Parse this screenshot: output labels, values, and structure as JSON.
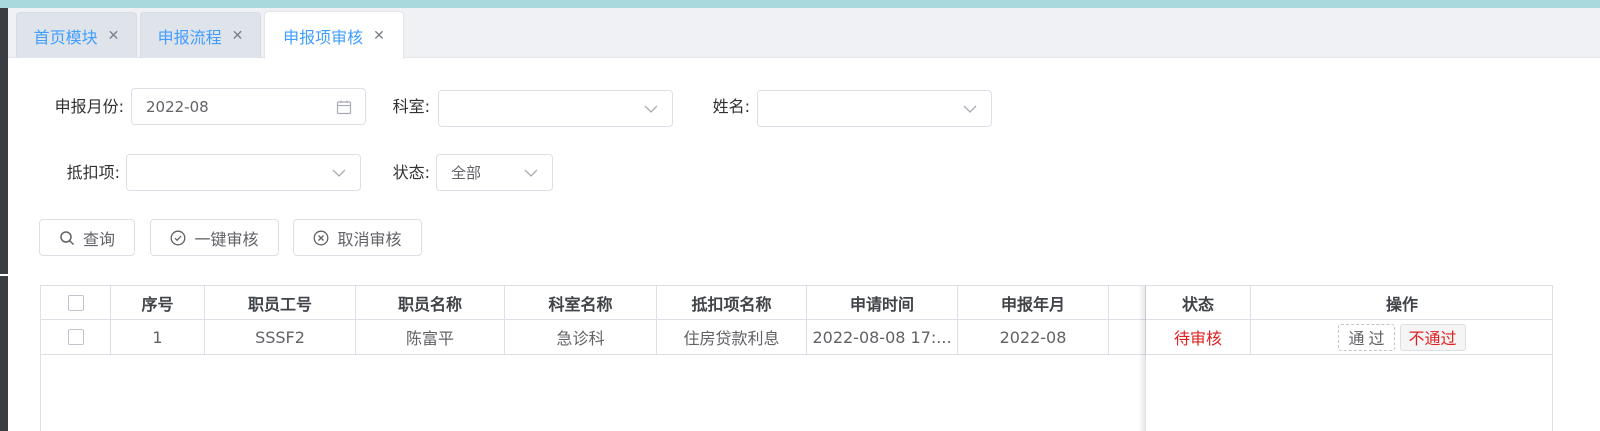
{
  "tabs": [
    {
      "label": "首页模块",
      "active": false
    },
    {
      "label": "申报流程",
      "active": false
    },
    {
      "label": "申报项审核",
      "active": true
    }
  ],
  "filters": {
    "month": {
      "label": "申报月份:",
      "value": "2022-08"
    },
    "department": {
      "label": "科室:",
      "value": ""
    },
    "name": {
      "label": "姓名:",
      "value": ""
    },
    "deduction": {
      "label": "抵扣项:",
      "value": ""
    },
    "status": {
      "label": "状态:",
      "value": "全部"
    }
  },
  "buttons": {
    "query": "查询",
    "approve_all": "一键审核",
    "cancel_review": "取消审核"
  },
  "table": {
    "headers": {
      "index": "序号",
      "employee_id": "职员工号",
      "employee_name": "职员名称",
      "department": "科室名称",
      "deduction_name": "抵扣项名称",
      "apply_time": "申请时间",
      "report_month": "申报年月",
      "status": "状态",
      "actions": "操作"
    },
    "rows": [
      {
        "index": "1",
        "employee_id": "SSSF2",
        "employee_name": "陈富平",
        "department": "急诊科",
        "deduction_name": "住房贷款利息",
        "apply_time": "2022-08-08 17:...",
        "report_month": "2022-08",
        "status": "待审核",
        "pass_label": "通过",
        "fail_label": "不通过"
      }
    ]
  },
  "colors": {
    "accent": "#409eff",
    "status_pending": "#e02020",
    "top_strip": "#a9d9dc"
  },
  "icons": [
    "close-icon",
    "calendar-icon",
    "chevron-down-icon",
    "search-icon",
    "check-circle-icon",
    "close-circle-icon",
    "checkbox"
  ]
}
